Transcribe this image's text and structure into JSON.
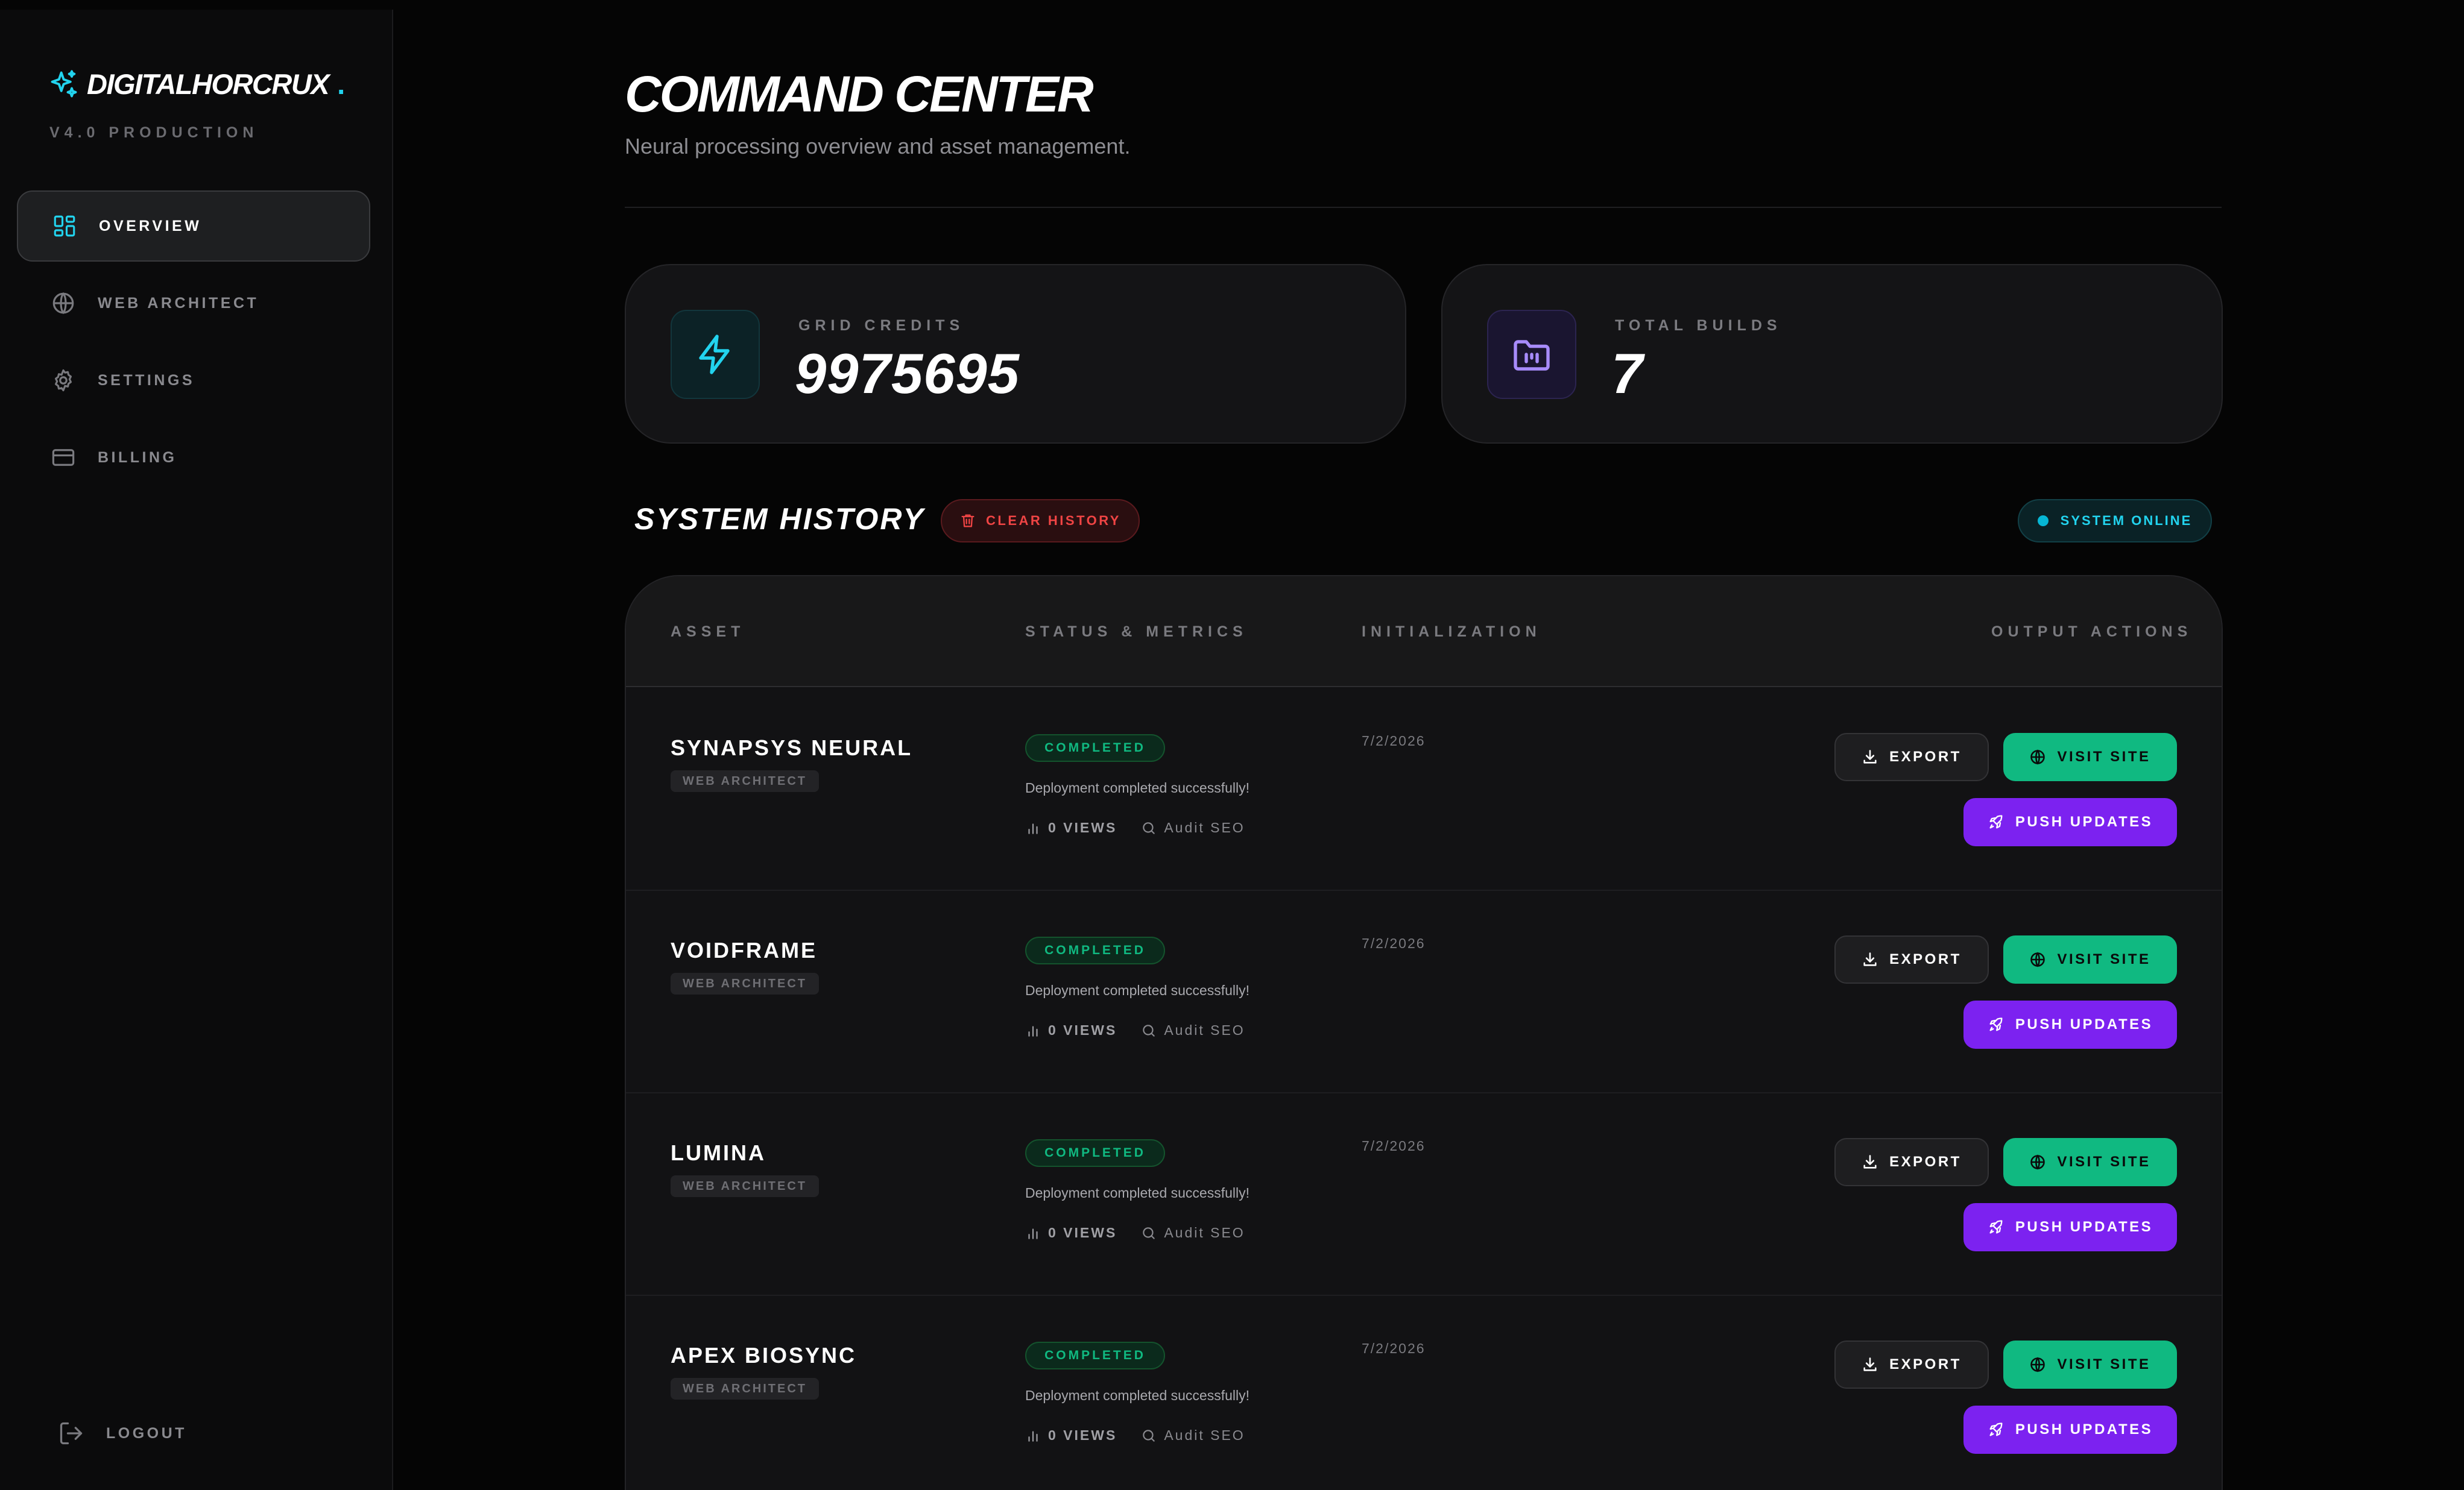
{
  "sidebar": {
    "brand": "DIGITALHORCRUX",
    "brand_dot": ".",
    "version": "V4.0 PRODUCTION",
    "nav": [
      {
        "label": "OVERVIEW",
        "icon": "dashboard-icon",
        "active": true
      },
      {
        "label": "WEB ARCHITECT",
        "icon": "globe-icon",
        "active": false
      },
      {
        "label": "SETTINGS",
        "icon": "gear-icon",
        "active": false
      },
      {
        "label": "BILLING",
        "icon": "credit-card-icon",
        "active": false
      }
    ],
    "logout": "LOGOUT"
  },
  "header": {
    "title": "COMMAND CENTER",
    "subtitle": "Neural processing overview and asset management."
  },
  "stats": [
    {
      "label": "GRID CREDITS",
      "value": "9975695",
      "icon": "lightning-icon",
      "accent": "#22d3ee"
    },
    {
      "label": "TOTAL BUILDS",
      "value": "7",
      "icon": "folder-icon",
      "accent": "#a78bfa"
    }
  ],
  "history": {
    "title": "SYSTEM HISTORY",
    "clear_label": "CLEAR HISTORY",
    "status_label": "SYSTEM ONLINE",
    "columns": [
      "ASSET",
      "STATUS & METRICS",
      "INITIALIZATION",
      "OUTPUT ACTIONS"
    ],
    "rows": [
      {
        "name": "SYNAPSYS NEURAL",
        "tag": "WEB ARCHITECT",
        "status": "COMPLETED",
        "message": "Deployment completed successfully!",
        "views": "0 VIEWS",
        "audit": "Audit SEO",
        "date": "7/2/2026"
      },
      {
        "name": "VOIDFRAME",
        "tag": "WEB ARCHITECT",
        "status": "COMPLETED",
        "message": "Deployment completed successfully!",
        "views": "0 VIEWS",
        "audit": "Audit SEO",
        "date": "7/2/2026"
      },
      {
        "name": "LUMINA",
        "tag": "WEB ARCHITECT",
        "status": "COMPLETED",
        "message": "Deployment completed successfully!",
        "views": "0 VIEWS",
        "audit": "Audit SEO",
        "date": "7/2/2026"
      },
      {
        "name": "APEX BIOSYNC",
        "tag": "WEB ARCHITECT",
        "status": "COMPLETED",
        "message": "Deployment completed successfully!",
        "views": "0 VIEWS",
        "audit": "Audit SEO",
        "date": "7/2/2026"
      }
    ],
    "actions": {
      "export": "EXPORT",
      "visit": "VISIT SITE",
      "push": "PUSH UPDATES"
    }
  },
  "colors": {
    "accent_cyan": "#22d3ee",
    "success_green": "#10b981",
    "push_purple": "#7c22f0",
    "danger_red": "#ef4444",
    "background": "#050505"
  }
}
